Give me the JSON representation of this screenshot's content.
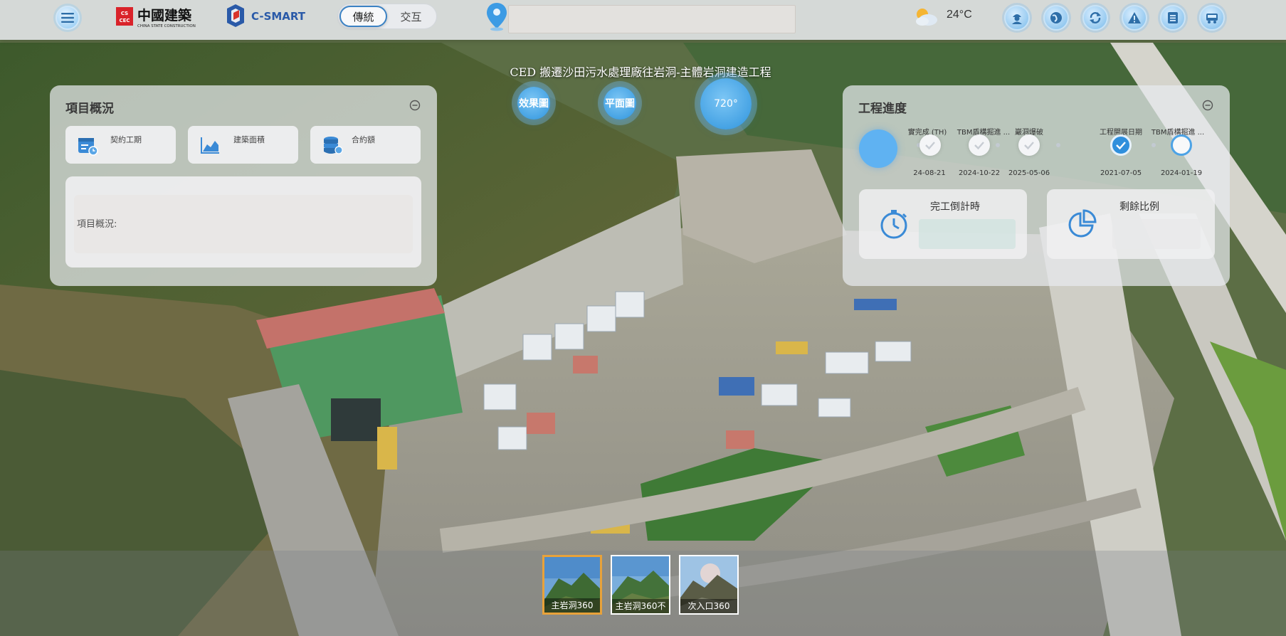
{
  "header": {
    "logo_cscec_text": "中國建築",
    "logo_cscec_subtext": "CHINA STATE CONSTRUCTION",
    "logo_csmart_text": "C-SMART",
    "mode_toggle": {
      "options": [
        "傳統",
        "交互"
      ],
      "selected": "傳統"
    },
    "address_value": "",
    "weather": {
      "icon": "partly-cloudy-icon",
      "temperature": "24°C"
    },
    "toolbar_icons": [
      "worker-icon",
      "globe-icon",
      "sync-icon",
      "warning-icon",
      "document-list-icon",
      "vehicle-icon"
    ]
  },
  "project": {
    "title": "CED 搬遷沙田污水處理廠往岩洞-主體岩洞建造工程",
    "view_buttons": [
      "效果圖",
      "平面圖",
      "720°"
    ]
  },
  "overview_panel": {
    "title": "項目概況",
    "cards": [
      {
        "label": "契約工期",
        "icon": "calendar-icon"
      },
      {
        "label": "建築面積",
        "icon": "area-chart-icon"
      },
      {
        "label": "合約額",
        "icon": "coins-icon"
      }
    ],
    "description_label": "項目概況:"
  },
  "progress_panel": {
    "title": "工程進度",
    "milestones": [
      {
        "label": "實完成 (TH)",
        "date": "24-08-21",
        "state": "done"
      },
      {
        "label": "TBM盾構掘進 ...",
        "date": "2024-10-22",
        "state": "done"
      },
      {
        "label": "巖洞爆破",
        "date": "2025-05-06",
        "state": "done"
      },
      {
        "label": "工程開展日期",
        "date": "2021-07-05",
        "state": "current"
      },
      {
        "label": "TBM盾構掘進 ...",
        "date": "2024-01-19",
        "state": "upcoming"
      }
    ],
    "countdown_label": "完工倒計時",
    "remaining_label": "剩餘比例"
  },
  "thumbnails": [
    {
      "caption": "主岩洞360",
      "selected": true
    },
    {
      "caption": "主岩洞360不",
      "selected": false
    },
    {
      "caption": "次入口360",
      "selected": false
    }
  ],
  "colors": {
    "accent_blue": "#2f94dd",
    "topbar_bg": "#e6e8ec",
    "selected_thumb_border": "#e8a23a",
    "csmart_red": "#d9342b",
    "csmart_blue": "#2a5aa8"
  }
}
